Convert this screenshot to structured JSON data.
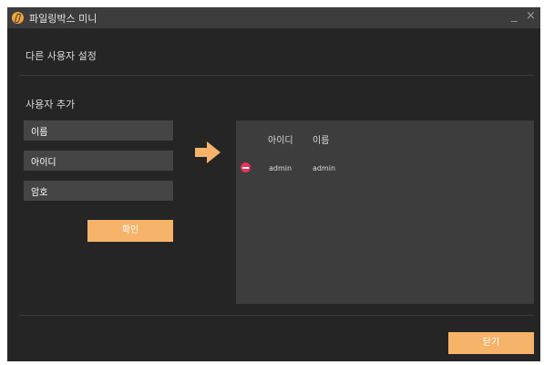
{
  "window": {
    "title": "파일링박스 미니",
    "minimize_glyph": "_",
    "close_glyph": "×",
    "icon": "app-logo-icon"
  },
  "settings": {
    "heading": "다른 사용자 설정",
    "add_heading": "사용자 추가"
  },
  "form": {
    "name_placeholder": "이름",
    "id_placeholder": "아이디",
    "password_placeholder": "암호",
    "confirm_label": "확인",
    "arrow_icon": "arrow-right-icon"
  },
  "user_table": {
    "columns": [
      "아이디",
      "이름"
    ],
    "rows": [
      {
        "id": "admin",
        "name": "admin",
        "action_icon": "remove-icon"
      }
    ]
  },
  "footer": {
    "close_label": "닫기"
  },
  "colors": {
    "accent": "#f6b36a",
    "background": "#252525",
    "panel": "#3d3d3d",
    "remove": "#e8325a"
  }
}
